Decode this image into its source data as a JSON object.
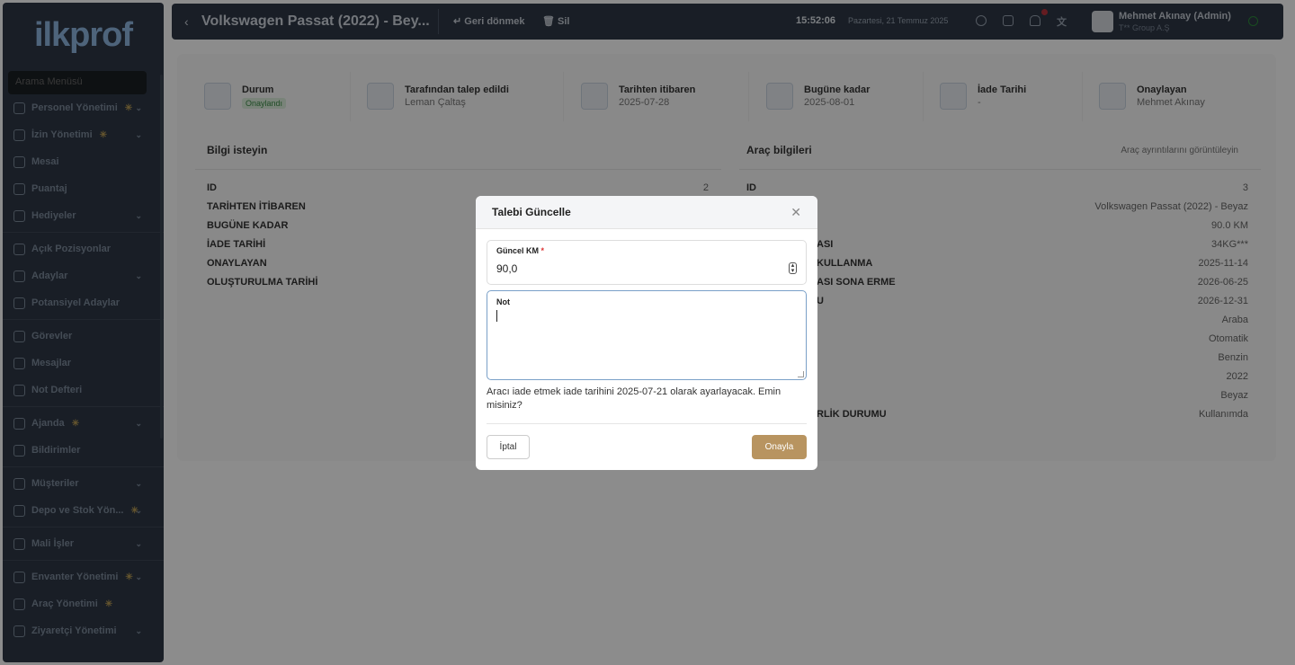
{
  "sidebar": {
    "logo": "ilkprof",
    "search_placeholder": "Arama Menüsü",
    "items": [
      {
        "label": "Personel Yönetimi",
        "star": true,
        "chevron": true
      },
      {
        "label": "İzin Yönetimi",
        "star": true,
        "chevron": true
      },
      {
        "label": "Mesai",
        "star": false,
        "chevron": false
      },
      {
        "label": "Puantaj",
        "star": false,
        "chevron": false
      },
      {
        "label": "Hediyeler",
        "star": false,
        "chevron": true
      },
      {
        "label": "Açık Pozisyonlar",
        "star": false,
        "chevron": false
      },
      {
        "label": "Adaylar",
        "star": false,
        "chevron": true
      },
      {
        "label": "Potansiyel Adaylar",
        "star": false,
        "chevron": false
      },
      {
        "label": "Görevler",
        "star": false,
        "chevron": false
      },
      {
        "label": "Mesajlar",
        "star": false,
        "chevron": false
      },
      {
        "label": "Not Defteri",
        "star": false,
        "chevron": false
      },
      {
        "label": "Ajanda",
        "star": true,
        "chevron": true
      },
      {
        "label": "Bildirimler",
        "star": false,
        "chevron": false
      },
      {
        "label": "Müşteriler",
        "star": false,
        "chevron": true
      },
      {
        "label": "Depo ve Stok Yön...",
        "star": true,
        "chevron": true
      },
      {
        "label": "Mali İşler",
        "star": false,
        "chevron": true
      },
      {
        "label": "Envanter Yönetimi",
        "star": true,
        "chevron": true
      },
      {
        "label": "Araç Yönetimi",
        "star": true,
        "chevron": false
      },
      {
        "label": "Ziyaretçi Yönetimi",
        "star": false,
        "chevron": true
      }
    ]
  },
  "topbar": {
    "back_icon": "chevron-left-icon",
    "title": "Volkswagen Passat (2022) - Bey...",
    "back_label": "↵ Geri dönmek",
    "delete_label": "🗑 Sil",
    "time": "15:52:06",
    "date": "Pazartesi, 21 Temmuz 2025",
    "user_name": "Mehmet Akınay (Admin)",
    "user_company": "T** Group A.Ş"
  },
  "info": [
    {
      "label": "Durum",
      "value": "Onaylandı",
      "badge": true
    },
    {
      "label": "Tarafından talep edildi",
      "value": "Leman Çaltaş"
    },
    {
      "label": "Tarihten itibaren",
      "value": "2025-07-28"
    },
    {
      "label": "Bugüne kadar",
      "value": "2025-08-01"
    },
    {
      "label": "İade Tarihi",
      "value": "-"
    },
    {
      "label": "Onaylayan",
      "value": "Mehmet Akınay"
    }
  ],
  "left_section": {
    "title": "Bilgi isteyin",
    "rows": [
      {
        "key": "ID",
        "value": "2"
      },
      {
        "key": "TARİHTEN İTİBAREN",
        "value": ""
      },
      {
        "key": "BUGÜNE KADAR",
        "value": ""
      },
      {
        "key": "İADE TARİHİ",
        "value": ""
      },
      {
        "key": "ONAYLAYAN",
        "value": ""
      },
      {
        "key": "OLUŞTURULMA TARİHİ",
        "value": ""
      }
    ]
  },
  "right_section": {
    "title": "Araç bilgileri",
    "link": "Araç ayrıntılarını görüntüleyin",
    "rows": [
      {
        "key": "ID",
        "value": "3"
      },
      {
        "key": "",
        "value": "Volkswagen Passat (2022) - Beyaz"
      },
      {
        "key": "",
        "value": "90.0 KM"
      },
      {
        "key": "ASI",
        "value": "34KG***"
      },
      {
        "key": "KULLANMA",
        "value": "2025-11-14"
      },
      {
        "key": "ASI SONA ERME",
        "value": "2026-06-25"
      },
      {
        "key": "U",
        "value": "2026-12-31"
      },
      {
        "key": "",
        "value": "Araba"
      },
      {
        "key": "",
        "value": "Otomatik"
      },
      {
        "key": "",
        "value": "Benzin"
      },
      {
        "key": "",
        "value": "2022"
      },
      {
        "key": "",
        "value": "Beyaz"
      },
      {
        "key": "RLİK DURUMU",
        "value": "Kullanımda"
      }
    ]
  },
  "modal": {
    "title": "Talebi Güncelle",
    "km_label": "Güncel KM",
    "km_required": "*",
    "km_value": "90,0",
    "note_label": "Not",
    "note_value": "",
    "message": "Aracı iade etmek iade tarihini 2025-07-21 olarak ayarlayacak. Emin misiniz?",
    "cancel_label": "İptal",
    "confirm_label": "Onayla"
  },
  "colors": {
    "sidebar_bg": "#2e3846",
    "accent": "#b89460",
    "badge_green": "#3a8b45"
  }
}
